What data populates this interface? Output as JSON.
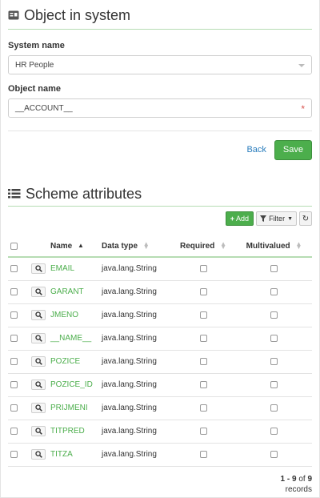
{
  "page": {
    "title": "Object in system",
    "title_icon": "object-icon"
  },
  "form": {
    "system_name_label": "System name",
    "system_name_value": "HR People",
    "object_name_label": "Object name",
    "object_name_value": "__ACCOUNT__",
    "required_marker": "*"
  },
  "actions": {
    "back_label": "Back",
    "save_label": "Save"
  },
  "attributes": {
    "title": "Scheme attributes",
    "add_label": "Add",
    "filter_label": "Filter",
    "columns": {
      "name": "Name",
      "data_type": "Data type",
      "required": "Required",
      "multivalued": "Multivalued"
    },
    "rows": [
      {
        "name": "EMAIL",
        "data_type": "java.lang.String"
      },
      {
        "name": "GARANT",
        "data_type": "java.lang.String"
      },
      {
        "name": "JMENO",
        "data_type": "java.lang.String"
      },
      {
        "name": "__NAME__",
        "data_type": "java.lang.String"
      },
      {
        "name": "POZICE",
        "data_type": "java.lang.String"
      },
      {
        "name": "POZICE_ID",
        "data_type": "java.lang.String"
      },
      {
        "name": "PRIJMENI",
        "data_type": "java.lang.String"
      },
      {
        "name": "TITPRED",
        "data_type": "java.lang.String"
      },
      {
        "name": "TITZA",
        "data_type": "java.lang.String"
      }
    ],
    "pagination": {
      "range": "1 - 9",
      "of": "of",
      "total": "9",
      "records_label": "records"
    }
  },
  "colors": {
    "accent_green": "#4cae4c",
    "link_blue": "#2a7dbd",
    "underline_green": "#b6dcb3",
    "required_red": "#d9534f"
  }
}
